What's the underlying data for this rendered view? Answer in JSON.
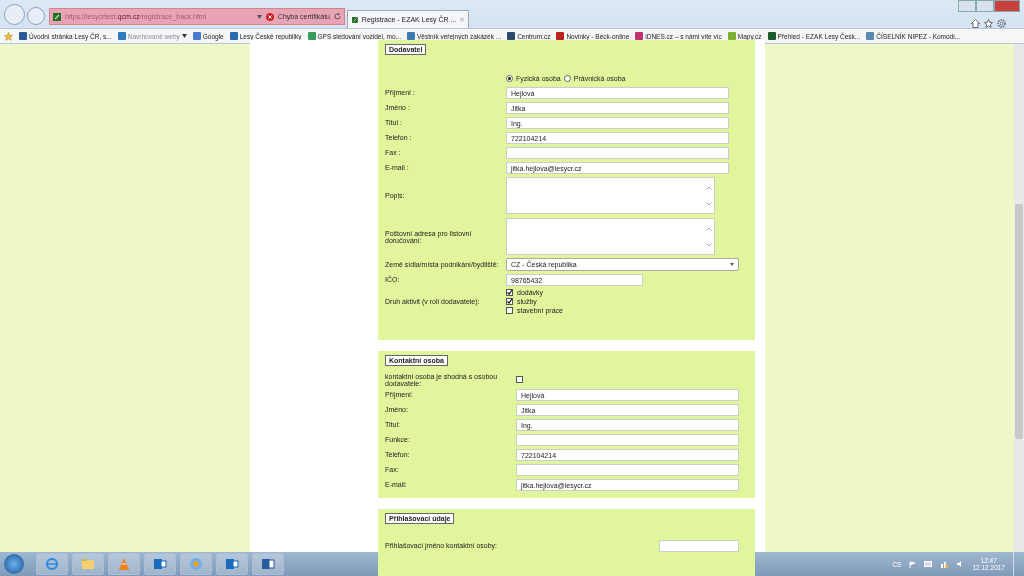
{
  "browser": {
    "address": {
      "prefix": "https://lesycrtest.",
      "domain": "qcm.cz",
      "path": "/registrace_back.html"
    },
    "certificate_error": "Chyba certifikátu",
    "tabs": [
      {
        "title": "Registrace - EZAK Lesy ČR ...",
        "selected": true
      }
    ],
    "bookmarks": [
      {
        "label": "Úvodní stránka  Lesy ČR, s...",
        "kind": "link",
        "color": "#2a5a9a"
      },
      {
        "label": "Navrhované weby",
        "kind": "menu",
        "color": "#2a7ac0"
      },
      {
        "label": "Google",
        "kind": "link",
        "color": "#4a7ad0"
      },
      {
        "label": "Lesy České republiky",
        "kind": "link",
        "color": "#2a6ab0"
      },
      {
        "label": "GPS sledování vozidel, mo...",
        "kind": "link",
        "color": "#3a9a5a"
      },
      {
        "label": "Věstník veřejných zakázek ...",
        "kind": "link",
        "color": "#3a7ab0"
      },
      {
        "label": "Centrum.cz",
        "kind": "link",
        "color": "#2a4a6a"
      },
      {
        "label": "Novinky - Beck-online",
        "kind": "link",
        "color": "#c02020"
      },
      {
        "label": "iDNES.cz – s námi víte víc",
        "kind": "link",
        "color": "#c03070"
      },
      {
        "label": "Mapy.cz",
        "kind": "link",
        "color": "#7ab030"
      },
      {
        "label": "Přehled - EZAK Lesy Česk...",
        "kind": "link",
        "color": "#1a5a2a"
      },
      {
        "label": "ČÍSELNÍK NIPEZ - Komodi...",
        "kind": "link",
        "color": "#5a8ab0"
      }
    ]
  },
  "supplier": {
    "legend": "Dodavatel",
    "person_types": [
      {
        "label": "Fyzická osoba",
        "selected": true
      },
      {
        "label": "Právnická osoba",
        "selected": false
      }
    ],
    "fields": [
      {
        "label": "Příjmení :",
        "value": "Hejlová",
        "kind": "text"
      },
      {
        "label": "Jméno :",
        "value": "Jitka",
        "kind": "text"
      },
      {
        "label": "Titul :",
        "value": "Ing.",
        "kind": "text"
      },
      {
        "label": "Telefon :",
        "value": "722104214",
        "kind": "text"
      },
      {
        "label": "Fax :",
        "kind": "text"
      },
      {
        "label": "E-mail :",
        "value": "jitka.hejlova@lesycr.cz",
        "kind": "text"
      },
      {
        "label": "Popis:",
        "kind": "textarea"
      },
      {
        "label": "Poštovní adresa pro listovní doručování:",
        "kind": "textarea"
      },
      {
        "label": "Země sídla/místa podnikání/bydliště:",
        "value": "CZ - Česká republika",
        "kind": "select"
      },
      {
        "label": "IČO:",
        "value": "98765432",
        "kind": "short"
      }
    ],
    "activities": {
      "label": "Druh aktivit (v roli dodavatele):",
      "options": [
        {
          "label": "dodávky",
          "checked": true
        },
        {
          "label": "služby",
          "checked": true
        },
        {
          "label": "stavební práce",
          "checked": false
        }
      ]
    }
  },
  "contact": {
    "legend": "Kontaktní osoba",
    "same_as_supplier": {
      "label": "kontaktní osoba je shodná s osobou dodavatele:",
      "checked": false
    },
    "fields": [
      {
        "label": "Příjmení:",
        "value": "Hejlová"
      },
      {
        "label": "Jméno:",
        "value": "Jitka"
      },
      {
        "label": "Titul:",
        "value": "Ing."
      },
      {
        "label": "Funkce:"
      },
      {
        "label": "Telefon:",
        "value": "722104214"
      },
      {
        "label": "Fax:"
      },
      {
        "label": "E-mail:",
        "value": "jitka.hejlova@lesycr.cz"
      }
    ]
  },
  "login": {
    "legend": "Přihlašovací údaje",
    "fields": [
      {
        "label": "Přihlašovací jméno kontaktní osoby:"
      }
    ]
  },
  "taskbar": {
    "language": "CS",
    "time": "12:47",
    "date": "12.12.2017"
  }
}
